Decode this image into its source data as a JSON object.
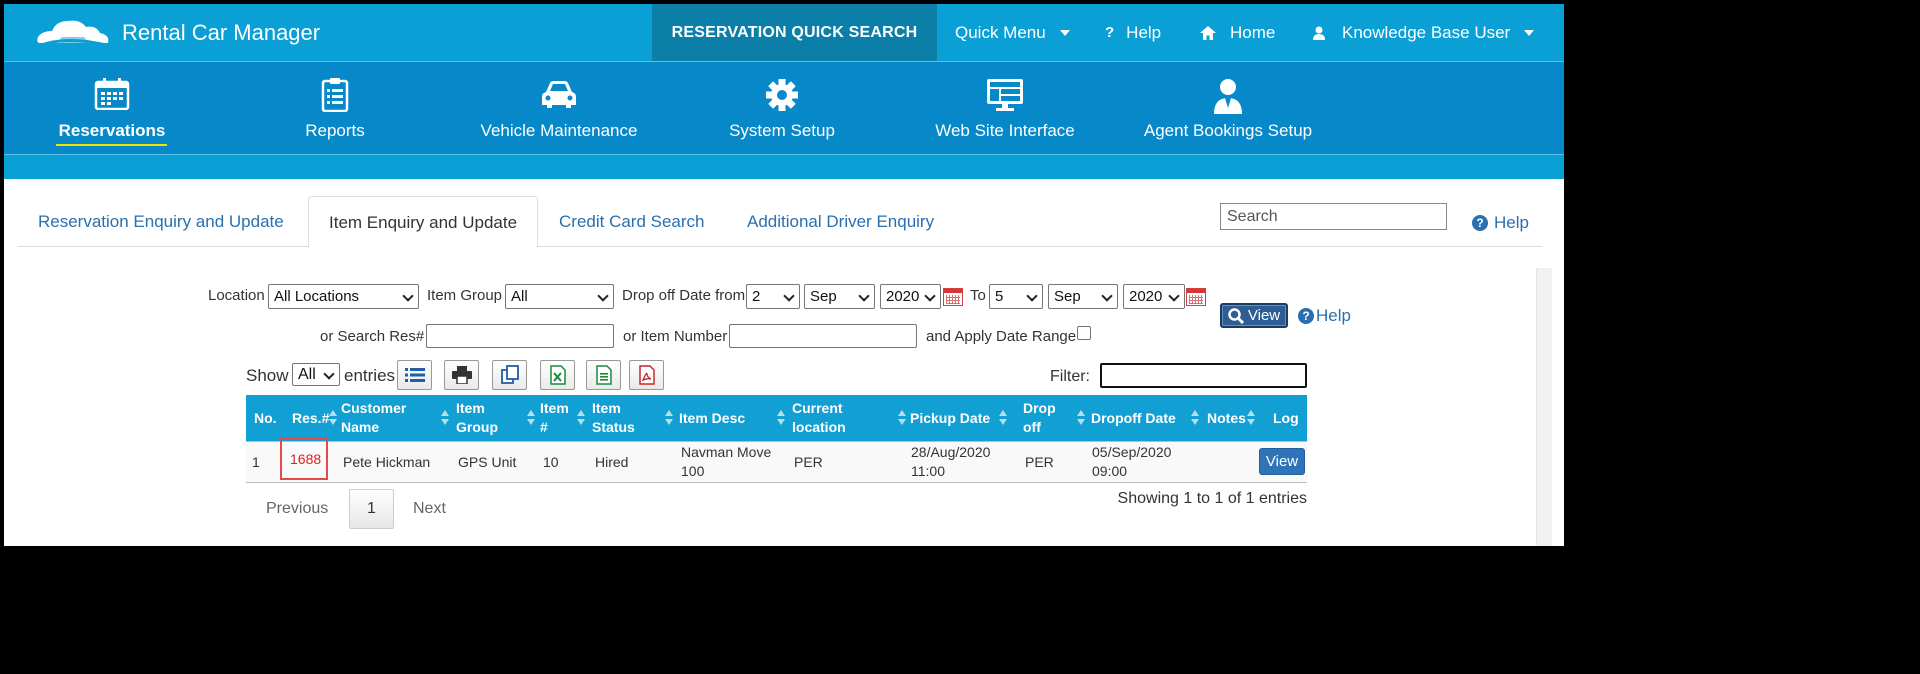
{
  "app": {
    "title": "Rental Car Manager"
  },
  "topbar": {
    "quick_search": "RESERVATION QUICK SEARCH",
    "quick_menu": "Quick Menu",
    "help": "Help",
    "home": "Home",
    "user": "Knowledge Base User"
  },
  "modules": [
    {
      "label": "Reservations",
      "icon": "calendar-icon",
      "active": true
    },
    {
      "label": "Reports",
      "icon": "clipboard-checklist-icon"
    },
    {
      "label": "Vehicle Maintenance",
      "icon": "car-icon"
    },
    {
      "label": "System Setup",
      "icon": "gear-icon"
    },
    {
      "label": "Web Site Interface",
      "icon": "monitor-icon"
    },
    {
      "label": "Agent Bookings Setup",
      "icon": "agent-icon"
    }
  ],
  "tabs": [
    {
      "label": "Reservation Enquiry and Update"
    },
    {
      "label": "Item Enquiry and Update",
      "active": true
    },
    {
      "label": "Credit Card Search"
    },
    {
      "label": "Additional Driver Enquiry"
    }
  ],
  "search": {
    "placeholder": "Search",
    "help": "Help"
  },
  "form": {
    "location_label": "Location",
    "location_value": "All Locations",
    "item_group_label": "Item Group",
    "item_group_value": "All",
    "dropoff_from_label": "Drop off Date from",
    "from_day": "2",
    "from_month": "Sep",
    "from_year": "2020",
    "to_label": "To",
    "to_day": "5",
    "to_month": "Sep",
    "to_year": "2020",
    "search_res_label": "or Search Res#",
    "item_number_label": "or Item Number",
    "apply_date_range_label": "and Apply Date Range",
    "view_button": "View",
    "help": "Help"
  },
  "toolbar": {
    "show_label": "Show",
    "show_value": "All",
    "entries_label": "entries",
    "buttons": [
      "column-list-icon",
      "print-icon",
      "copy-icon",
      "excel-icon",
      "csv-icon",
      "pdf-icon"
    ],
    "filter_label": "Filter:"
  },
  "table": {
    "headers": [
      "No.",
      "Res.#",
      "Customer Name",
      "Item Group",
      "Item #",
      "Item Status",
      "Item Desc",
      "Current location",
      "Pickup Date",
      "Drop off",
      "Dropoff Date",
      "Notes",
      "Log"
    ],
    "rows": [
      {
        "no": "1",
        "res": "1688",
        "customer": "Pete Hickman",
        "item_group": "GPS Unit",
        "item_no": "10",
        "status": "Hired",
        "desc": "Navman Move 100",
        "location": "PER",
        "pickup": "28/Aug/2020 11:00",
        "dropoff_loc": "PER",
        "dropoff_date": "05/Sep/2020 09:00",
        "notes": "",
        "log_button": "View"
      }
    ]
  },
  "pagination": {
    "previous": "Previous",
    "page": "1",
    "next": "Next",
    "info": "Showing 1 to 1 of 1 entries"
  },
  "colors": {
    "topbar": "#0aa0d6",
    "module_nav": "#0788c9",
    "accent_underline": "#f1e400",
    "link": "#2a6fb0",
    "highlight": "#e34b4b"
  }
}
